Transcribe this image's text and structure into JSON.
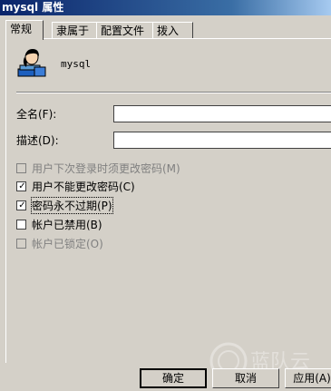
{
  "window": {
    "title": "mysql 属性"
  },
  "tabs": [
    {
      "label": "常规"
    },
    {
      "label": "隶属于"
    },
    {
      "label": "配置文件"
    },
    {
      "label": "拨入"
    }
  ],
  "user": {
    "name": "mysql"
  },
  "fields": {
    "fullname_label": "全名(F):",
    "fullname_value": "",
    "desc_label": "描述(D):",
    "desc_value": ""
  },
  "options": [
    {
      "label": "用户下次登录时须更改密码(M)",
      "checked": false,
      "disabled": true
    },
    {
      "label": "用户不能更改密码(C)",
      "checked": true,
      "disabled": false
    },
    {
      "label": "密码永不过期(P)",
      "checked": true,
      "disabled": false
    },
    {
      "label": "帐户已禁用(B)",
      "checked": false,
      "disabled": false
    },
    {
      "label": "帐户已锁定(O)",
      "checked": false,
      "disabled": true
    }
  ],
  "buttons": {
    "ok": "确定",
    "cancel": "取消",
    "apply": "应用(A)"
  },
  "watermark": {
    "text": "蓝队云"
  }
}
